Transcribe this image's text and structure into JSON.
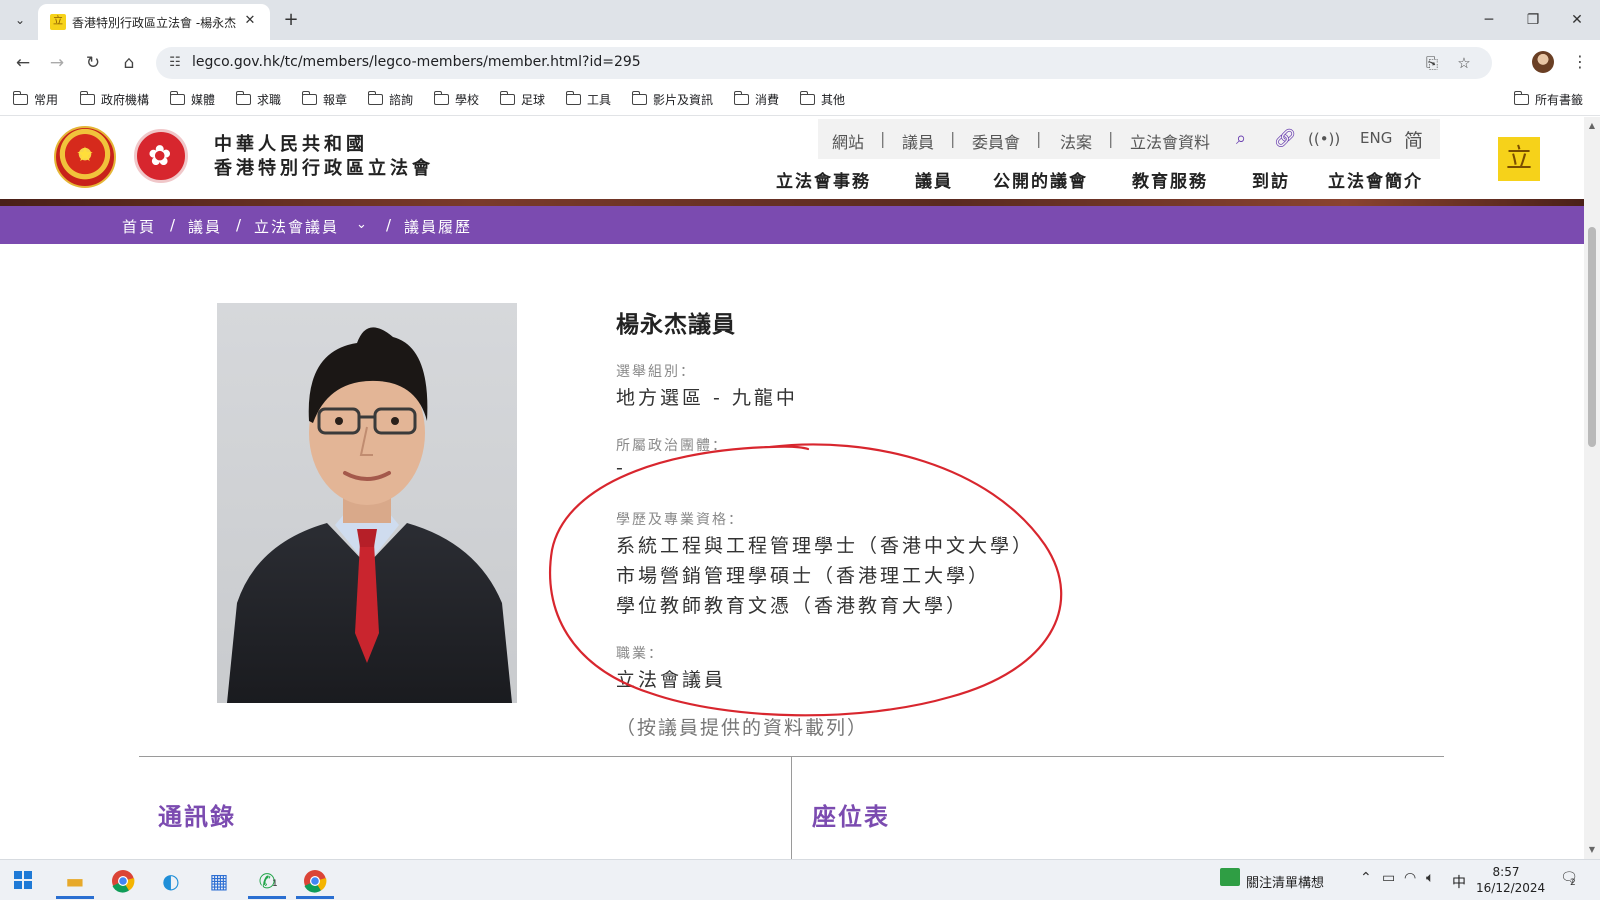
{
  "browser": {
    "tab_title": "香港特別行政區立法會 -楊永杰",
    "url": "legco.gov.hk/tc/members/legco-members/member.html?id=295",
    "bookmarks": [
      "常用",
      "政府機構",
      "媒體",
      "求職",
      "報章",
      "諮詢",
      "學校",
      "足球",
      "工具",
      "影片及資訊",
      "消費",
      "其他"
    ],
    "all_bookmarks": "所有書籤"
  },
  "site": {
    "org_line1": "中華人民共和國",
    "org_line2": "香港特別行政區立法會",
    "utility_links": [
      "網站",
      "議員",
      "委員會",
      "法案",
      "立法會資料"
    ],
    "lang_eng": "ENG",
    "lang_sc": "简",
    "logo_glyph": "立",
    "main_nav": [
      "立法會事務",
      "議員",
      "公開的議會",
      "教育服務",
      "到訪",
      "立法會簡介"
    ],
    "breadcrumb": [
      "首頁",
      "議員",
      "立法會議員",
      "議員履歷"
    ],
    "brand_purple": "#7b4bb0"
  },
  "member": {
    "name": "楊永杰議員",
    "constituency_label": "選舉組別：",
    "constituency": "地方選區 - 九龍中",
    "affiliation_label": "所屬政治團體：",
    "affiliation": "-",
    "qualifications_label": "學歷及專業資格：",
    "qualifications": [
      "系統工程與工程管理學士（香港中文大學）",
      "市場營銷管理學碩士（香港理工大學）",
      "學位教師教育文憑（香港教育大學）"
    ],
    "occupation_label": "職業：",
    "occupation": "立法會議員",
    "note": "（按議員提供的資料載列）"
  },
  "sections": {
    "directory": "通訊錄",
    "seating": "座位表"
  },
  "taskbar": {
    "tray_label": "關注清單構想",
    "ime": "中",
    "time": "8:57",
    "date": "16/12/2024",
    "whatsapp_badge": "1",
    "notification_count": "2"
  },
  "annotation": {
    "circle_color": "#d8262e"
  }
}
